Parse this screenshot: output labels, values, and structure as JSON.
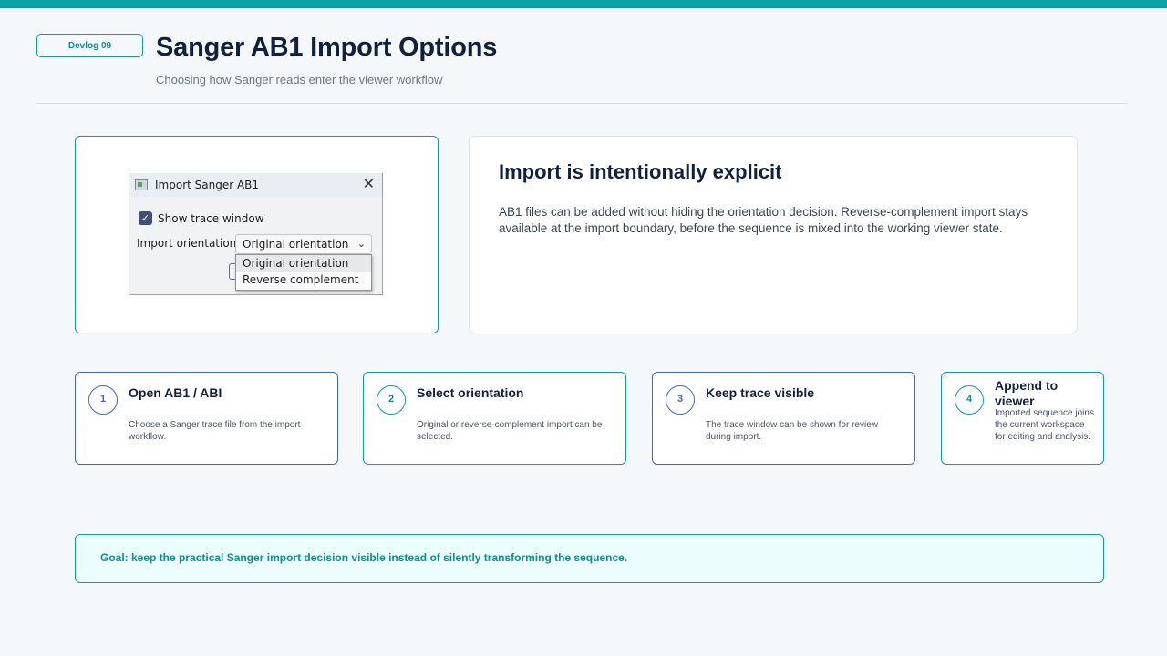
{
  "colors": {
    "accent_teal": "#0aa3a3",
    "accent_blue": "#3f63d2",
    "heading": "#10203d",
    "background": "#f4f8fb"
  },
  "header": {
    "badge": "Devlog 09",
    "title": "Sanger AB1 Import Options",
    "subtitle": "Choosing how Sanger reads enter the viewer workflow"
  },
  "dialog": {
    "title": "Import Sanger AB1",
    "app_icon": "app-window-icon",
    "close_icon": "close-icon",
    "checkbox_label": "Show trace window",
    "checkbox_checked": true,
    "orientation_label": "Import orientation",
    "combo_value": "Original orientation",
    "options": [
      "Original orientation",
      "Reverse complement"
    ]
  },
  "info": {
    "title": "Import is intentionally explicit",
    "body": "AB1 files can be added without hiding the orientation decision. Reverse-complement import stays available at the import boundary, before the sequence is mixed into the working viewer state."
  },
  "steps": [
    {
      "number": "1",
      "title": "Open AB1 / ABI",
      "desc": "Choose a Sanger trace file from the import workflow."
    },
    {
      "number": "2",
      "title": "Select orientation",
      "desc": "Original or reverse-complement import can be selected."
    },
    {
      "number": "3",
      "title": "Keep trace visible",
      "desc": "The trace window can be shown for review during import."
    },
    {
      "number": "4",
      "title": "Append to viewer",
      "desc": "Imported sequence joins the current workspace for editing and analysis."
    }
  ],
  "goal": "Goal: keep the practical Sanger import decision visible instead of silently transforming the sequence."
}
